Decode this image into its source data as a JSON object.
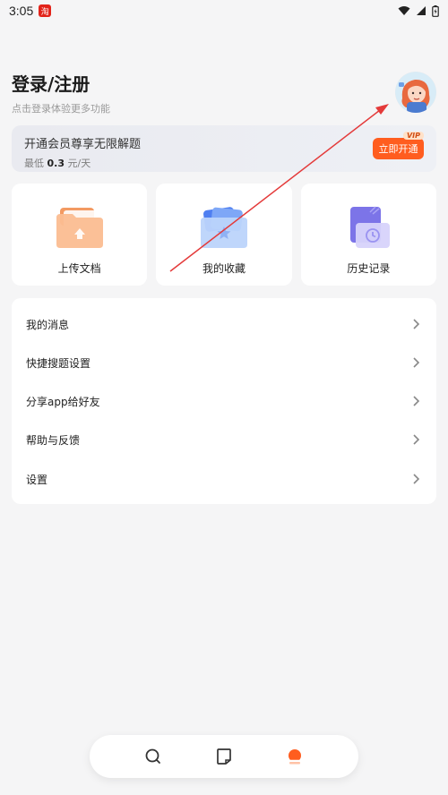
{
  "status_bar": {
    "time": "3:05",
    "app_icon_label": "淘"
  },
  "header": {
    "title": "登录/注册",
    "subtitle": "点击登录体验更多功能"
  },
  "vip": {
    "title": "开通会员尊享无限解题",
    "price_prefix": "最低",
    "price_value": "0.3",
    "price_unit": "元/天",
    "button_label": "立即开通",
    "badge": "VIP"
  },
  "quick_actions": [
    {
      "label": "上传文档",
      "icon": "folder-upload-icon"
    },
    {
      "label": "我的收藏",
      "icon": "folder-star-icon"
    },
    {
      "label": "历史记录",
      "icon": "history-clock-icon"
    }
  ],
  "menu": [
    {
      "label": "我的消息"
    },
    {
      "label": "快捷搜题设置"
    },
    {
      "label": "分享app给好友"
    },
    {
      "label": "帮助与反馈"
    },
    {
      "label": "设置"
    }
  ],
  "bottom_nav": [
    {
      "name": "search",
      "icon": "search-icon",
      "active": false
    },
    {
      "name": "document",
      "icon": "document-icon",
      "active": false
    },
    {
      "name": "profile",
      "icon": "profile-icon",
      "active": true
    }
  ],
  "colors": {
    "accent": "#ff5d1f",
    "background": "#f5f5f6",
    "annotation_arrow": "#e43a3a"
  }
}
